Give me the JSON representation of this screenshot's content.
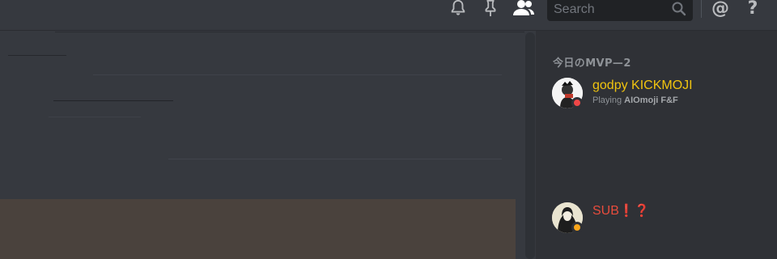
{
  "toolbar": {
    "icons": [
      "bell-icon",
      "pin-icon",
      "members-icon",
      "search-icon",
      "at-icon",
      "help-icon"
    ],
    "search_placeholder": "Search",
    "mention_glyph": "@",
    "help_glyph": "?"
  },
  "members": {
    "group_header": "今日のMVP—2",
    "list": [
      {
        "name": "godpy KICKMOJI",
        "name_color": "#f1c40f",
        "status": "dnd",
        "status_color": "#f04747",
        "activity_prefix": "Playing",
        "activity_game": "AIOmoji F&F"
      },
      {
        "name": "SUB",
        "name_suffix": "❗❓",
        "name_color": "#e74c3c",
        "status": "idle",
        "status_color": "#faa61a"
      }
    ]
  },
  "colors": {
    "background": "#36393f",
    "sidebar": "#2f3136",
    "header_text": "#8e9297"
  }
}
